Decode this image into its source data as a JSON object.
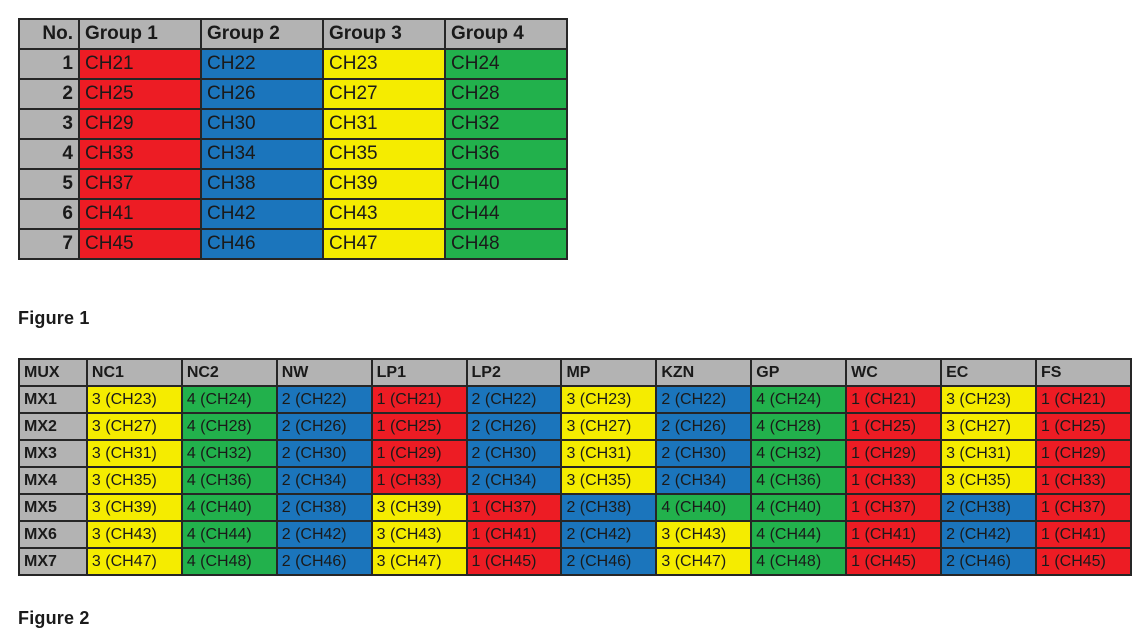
{
  "colors": {
    "red": "#ed1c24",
    "blue": "#1b75bc",
    "yellow": "#f5ec00",
    "green": "#22b14c",
    "header_gray": "#b3b3b3",
    "grid_line": "#262626",
    "text": "#1a1a1a"
  },
  "figure1": {
    "caption": "Figure 1",
    "columns": [
      "No.",
      "Group 1",
      "Group 2",
      "Group 3",
      "Group 4"
    ],
    "rows": [
      {
        "no": "1",
        "cells": [
          {
            "text": "CH21",
            "color": "red"
          },
          {
            "text": "CH22",
            "color": "blue"
          },
          {
            "text": "CH23",
            "color": "yellow"
          },
          {
            "text": "CH24",
            "color": "green"
          }
        ]
      },
      {
        "no": "2",
        "cells": [
          {
            "text": "CH25",
            "color": "red"
          },
          {
            "text": "CH26",
            "color": "blue"
          },
          {
            "text": "CH27",
            "color": "yellow"
          },
          {
            "text": "CH28",
            "color": "green"
          }
        ]
      },
      {
        "no": "3",
        "cells": [
          {
            "text": "CH29",
            "color": "red"
          },
          {
            "text": "CH30",
            "color": "blue"
          },
          {
            "text": "CH31",
            "color": "yellow"
          },
          {
            "text": "CH32",
            "color": "green"
          }
        ]
      },
      {
        "no": "4",
        "cells": [
          {
            "text": "CH33",
            "color": "red"
          },
          {
            "text": "CH34",
            "color": "blue"
          },
          {
            "text": "CH35",
            "color": "yellow"
          },
          {
            "text": "CH36",
            "color": "green"
          }
        ]
      },
      {
        "no": "5",
        "cells": [
          {
            "text": "CH37",
            "color": "red"
          },
          {
            "text": "CH38",
            "color": "blue"
          },
          {
            "text": "CH39",
            "color": "yellow"
          },
          {
            "text": "CH40",
            "color": "green"
          }
        ]
      },
      {
        "no": "6",
        "cells": [
          {
            "text": "CH41",
            "color": "red"
          },
          {
            "text": "CH42",
            "color": "blue"
          },
          {
            "text": "CH43",
            "color": "yellow"
          },
          {
            "text": "CH44",
            "color": "green"
          }
        ]
      },
      {
        "no": "7",
        "cells": [
          {
            "text": "CH45",
            "color": "red"
          },
          {
            "text": "CH46",
            "color": "blue"
          },
          {
            "text": "CH47",
            "color": "yellow"
          },
          {
            "text": "CH48",
            "color": "green"
          }
        ]
      }
    ]
  },
  "figure2": {
    "caption": "Figure 2",
    "columns": [
      "MUX",
      "NC1",
      "NC2",
      "NW",
      "LP1",
      "LP2",
      "MP",
      "KZN",
      "GP",
      "WC",
      "EC",
      "FS"
    ],
    "rows": [
      {
        "mux": "MX1",
        "cells": [
          {
            "text": "3 (CH23)",
            "color": "yellow"
          },
          {
            "text": "4 (CH24)",
            "color": "green"
          },
          {
            "text": "2 (CH22)",
            "color": "blue"
          },
          {
            "text": "1 (CH21)",
            "color": "red"
          },
          {
            "text": "2 (CH22)",
            "color": "blue"
          },
          {
            "text": "3 (CH23)",
            "color": "yellow"
          },
          {
            "text": "2 (CH22)",
            "color": "blue"
          },
          {
            "text": "4 (CH24)",
            "color": "green"
          },
          {
            "text": "1 (CH21)",
            "color": "red"
          },
          {
            "text": "3 (CH23)",
            "color": "yellow"
          },
          {
            "text": "1 (CH21)",
            "color": "red"
          }
        ]
      },
      {
        "mux": "MX2",
        "cells": [
          {
            "text": "3 (CH27)",
            "color": "yellow"
          },
          {
            "text": "4 (CH28)",
            "color": "green"
          },
          {
            "text": "2 (CH26)",
            "color": "blue"
          },
          {
            "text": "1 (CH25)",
            "color": "red"
          },
          {
            "text": "2 (CH26)",
            "color": "blue"
          },
          {
            "text": "3 (CH27)",
            "color": "yellow"
          },
          {
            "text": "2 (CH26)",
            "color": "blue"
          },
          {
            "text": "4 (CH28)",
            "color": "green"
          },
          {
            "text": "1 (CH25)",
            "color": "red"
          },
          {
            "text": "3 (CH27)",
            "color": "yellow"
          },
          {
            "text": "1 (CH25)",
            "color": "red"
          }
        ]
      },
      {
        "mux": "MX3",
        "cells": [
          {
            "text": "3 (CH31)",
            "color": "yellow"
          },
          {
            "text": "4 (CH32)",
            "color": "green"
          },
          {
            "text": "2 (CH30)",
            "color": "blue"
          },
          {
            "text": "1 (CH29)",
            "color": "red"
          },
          {
            "text": "2 (CH30)",
            "color": "blue"
          },
          {
            "text": "3 (CH31)",
            "color": "yellow"
          },
          {
            "text": "2 (CH30)",
            "color": "blue"
          },
          {
            "text": "4 (CH32)",
            "color": "green"
          },
          {
            "text": "1 (CH29)",
            "color": "red"
          },
          {
            "text": "3 (CH31)",
            "color": "yellow"
          },
          {
            "text": "1 (CH29)",
            "color": "red"
          }
        ]
      },
      {
        "mux": "MX4",
        "cells": [
          {
            "text": "3 (CH35)",
            "color": "yellow"
          },
          {
            "text": "4 (CH36)",
            "color": "green"
          },
          {
            "text": "2 (CH34)",
            "color": "blue"
          },
          {
            "text": "1 (CH33)",
            "color": "red"
          },
          {
            "text": "2 (CH34)",
            "color": "blue"
          },
          {
            "text": "3 (CH35)",
            "color": "yellow"
          },
          {
            "text": "2 (CH34)",
            "color": "blue"
          },
          {
            "text": "4 (CH36)",
            "color": "green"
          },
          {
            "text": "1 (CH33)",
            "color": "red"
          },
          {
            "text": "3 (CH35)",
            "color": "yellow"
          },
          {
            "text": "1 (CH33)",
            "color": "red"
          }
        ]
      },
      {
        "mux": "MX5",
        "cells": [
          {
            "text": "3 (CH39)",
            "color": "yellow"
          },
          {
            "text": "4 (CH40)",
            "color": "green"
          },
          {
            "text": "2 (CH38)",
            "color": "blue"
          },
          {
            "text": "3 (CH39)",
            "color": "yellow"
          },
          {
            "text": "1 (CH37)",
            "color": "red"
          },
          {
            "text": "2 (CH38)",
            "color": "blue"
          },
          {
            "text": "4 (CH40)",
            "color": "green"
          },
          {
            "text": "4 (CH40)",
            "color": "green"
          },
          {
            "text": "1 (CH37)",
            "color": "red"
          },
          {
            "text": "2 (CH38)",
            "color": "blue"
          },
          {
            "text": "1 (CH37)",
            "color": "red"
          }
        ]
      },
      {
        "mux": "MX6",
        "cells": [
          {
            "text": "3 (CH43)",
            "color": "yellow"
          },
          {
            "text": "4 (CH44)",
            "color": "green"
          },
          {
            "text": "2 (CH42)",
            "color": "blue"
          },
          {
            "text": "3 (CH43)",
            "color": "yellow"
          },
          {
            "text": "1 (CH41)",
            "color": "red"
          },
          {
            "text": "2 (CH42)",
            "color": "blue"
          },
          {
            "text": "3 (CH43)",
            "color": "yellow"
          },
          {
            "text": "4 (CH44)",
            "color": "green"
          },
          {
            "text": "1 (CH41)",
            "color": "red"
          },
          {
            "text": "2 (CH42)",
            "color": "blue"
          },
          {
            "text": "1 (CH41)",
            "color": "red"
          }
        ]
      },
      {
        "mux": "MX7",
        "cells": [
          {
            "text": "3 (CH47)",
            "color": "yellow"
          },
          {
            "text": "4 (CH48)",
            "color": "green"
          },
          {
            "text": "2 (CH46)",
            "color": "blue"
          },
          {
            "text": "3 (CH47)",
            "color": "yellow"
          },
          {
            "text": "1 (CH45)",
            "color": "red"
          },
          {
            "text": "2 (CH46)",
            "color": "blue"
          },
          {
            "text": "3 (CH47)",
            "color": "yellow"
          },
          {
            "text": "4 (CH48)",
            "color": "green"
          },
          {
            "text": "1 (CH45)",
            "color": "red"
          },
          {
            "text": "2 (CH46)",
            "color": "blue"
          },
          {
            "text": "1 (CH45)",
            "color": "red"
          }
        ]
      }
    ]
  }
}
